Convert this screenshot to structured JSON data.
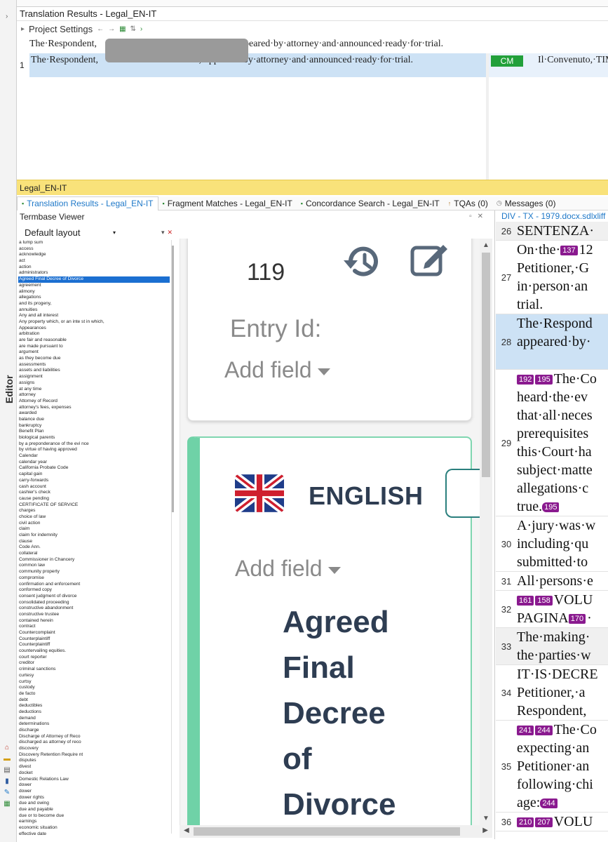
{
  "translation_results": {
    "title": "Translation Results - Legal_EN-IT",
    "project_settings": "Project Settings",
    "source_line": "The·Respondent,",
    "source_line_tail": "peared·by·attorney·and·announced·ready·for·trial.",
    "row_number": "1",
    "row_source_start": "The·Respondent,",
    "row_source_end": ",·appeared·by·attorney·and·announced·ready·for·trial.",
    "match_badge": "CM",
    "row_target": "Il·Convenuto,·TIM all’udienza."
  },
  "project_bar": "Legal_EN-IT",
  "tabs": [
    {
      "label": "Translation Results - Legal_EN-IT",
      "active": true
    },
    {
      "label": "Fragment Matches - Legal_EN-IT",
      "active": false
    },
    {
      "label": "Concordance Search - Legal_EN-IT",
      "active": false
    },
    {
      "label": "TQAs (0)",
      "active": false
    },
    {
      "label": "Messages (0)",
      "active": false
    }
  ],
  "termbase": {
    "title": "Termbase Viewer",
    "layout": "Default layout",
    "selected_term": "Agreed Final Decree of Divorce",
    "terms": [
      "a lump sum",
      "access",
      "acknowledge",
      "act",
      "action",
      "administrators",
      "Agreed Final Decree of Divorce",
      "agreement",
      "alimony",
      "allegations",
      "and its progeny,",
      "annuities",
      "Any and all interest",
      "Any property which, or an inte    st in which,",
      "Appearances",
      "arbitration",
      "are fair and reasonable",
      "are made pursuant to",
      "argument",
      "as they become due",
      "assessments",
      "assets and liabilities",
      "assignment",
      "assigns",
      "at any time",
      "attorney",
      "Attorney of Record",
      "attorney's fees, expenses",
      "awarded",
      "balance due",
      "bankruptcy",
      "Benefit Plan",
      "biological parents",
      "by a preponderance of the evi   nce",
      "by virtue of having approved",
      "Calendar",
      "calendar year",
      "California Probate Code",
      "capital gain",
      "carry-forwards",
      "cash account",
      "cashier's check",
      "cause pending",
      "CERTIFICATE OF SERVICE",
      "charges",
      "choice of law",
      "civil action",
      "claim",
      "claim for indemnity",
      "clause",
      "Code Ann.",
      "collateral",
      "Commissioner in Chancery",
      "common law",
      "community property",
      "compromise",
      "confirmation and enforcement",
      "conformed copy",
      "consent judgment of divorce",
      "consolidated proceeding",
      "constructive abandonment",
      "constructive trustee",
      "contained herein",
      "contract",
      "Countercomplaint",
      "Counterplaintiff",
      "Counterplaintiff",
      "countervailing equities.",
      "court reporter",
      "creditor",
      "criminal sanctions",
      "curtesy",
      "curtsy",
      "custody",
      "de facto",
      "debt",
      "deductibles",
      "deductions",
      "demand",
      "determinations",
      "discharge",
      "Discharge of Attorney of Reco",
      "discharged as attorney of reco",
      "discovery",
      "Discovery  Retention Require     nt",
      "disputes",
      "divest",
      "docket",
      "Domestic Relations Law",
      "dower",
      "dower",
      "dower rights",
      "due and owing",
      "due and payable",
      "due or to become due",
      "earnings",
      "economic situation",
      "effective date"
    ],
    "entry": {
      "entry_id_value": "119",
      "entry_id_label": "Entry Id:",
      "add_field": "Add field",
      "language": "ENGLISH",
      "add_field_2": "Add field",
      "term_lines": [
        "Agreed",
        "Final",
        "Decree",
        "of",
        "Divorce"
      ]
    }
  },
  "editor": {
    "title": "DIV - TX - 1979.docx.sdlxliff [",
    "rows": [
      {
        "n": "26",
        "lines": [
          [
            {
              "text": "SENTENZA·"
            }
          ]
        ],
        "style": "grey"
      },
      {
        "n": "27",
        "lines": [
          [
            {
              "text": "On·the·"
            },
            {
              "tag": "137"
            },
            {
              "text": "12"
            }
          ],
          [
            {
              "text": "Petitioner,·G"
            }
          ],
          [
            {
              "text": "in·person·an"
            }
          ],
          [
            {
              "text": "trial."
            }
          ]
        ],
        "style": ""
      },
      {
        "n": "28",
        "lines": [
          [
            {
              "text": "The·Respond"
            }
          ],
          [
            {
              "text": "appeared·by·"
            }
          ],
          [
            {
              "text": ""
            }
          ]
        ],
        "style": "hl"
      },
      {
        "n": "29",
        "lines": [
          [
            {
              "tag": "192"
            },
            {
              "tag": "195"
            },
            {
              "text": "The·Co"
            }
          ],
          [
            {
              "text": "heard·the·ev"
            }
          ],
          [
            {
              "text": "that·all·neces"
            }
          ],
          [
            {
              "text": "prerequisites"
            }
          ],
          [
            {
              "text": "this·Court·ha"
            }
          ],
          [
            {
              "text": "subject·matte"
            }
          ],
          [
            {
              "text": "allegations·c"
            }
          ],
          [
            {
              "text": "true."
            },
            {
              "tagend": "195"
            }
          ]
        ],
        "style": ""
      },
      {
        "n": "30",
        "lines": [
          [
            {
              "text": "A·jury·was·w"
            }
          ],
          [
            {
              "text": "including·qu"
            }
          ],
          [
            {
              "text": "submitted·to"
            }
          ]
        ],
        "style": ""
      },
      {
        "n": "31",
        "lines": [
          [
            {
              "text": "All·persons·e"
            }
          ]
        ],
        "style": ""
      },
      {
        "n": "32",
        "lines": [
          [
            {
              "tag": "161"
            },
            {
              "tag": "158"
            },
            {
              "text": "VOLU"
            }
          ],
          [
            {
              "text": "PAGINA"
            },
            {
              "tag": "170"
            },
            {
              "text": "·"
            }
          ]
        ],
        "style": ""
      },
      {
        "n": "33",
        "lines": [
          [
            {
              "text": "The·making·"
            }
          ],
          [
            {
              "text": "the·parties·w"
            }
          ]
        ],
        "style": "grey"
      },
      {
        "n": "34",
        "lines": [
          [
            {
              "text": "IT·IS·DECRE"
            }
          ],
          [
            {
              "text": "Petitioner,·a"
            }
          ],
          [
            {
              "text": "Respondent,"
            }
          ]
        ],
        "style": ""
      },
      {
        "n": "35",
        "lines": [
          [
            {
              "tag": "241"
            },
            {
              "tag": "244"
            },
            {
              "text": "The·Co"
            }
          ],
          [
            {
              "text": "expecting·an"
            }
          ],
          [
            {
              "text": "Petitioner·an"
            }
          ],
          [
            {
              "text": "following·chi"
            }
          ],
          [
            {
              "text": "age:"
            },
            {
              "tagend": "244"
            }
          ]
        ],
        "style": ""
      },
      {
        "n": "36",
        "lines": [
          [
            {
              "tag": "210"
            },
            {
              "tag": "207"
            },
            {
              "text": "VOLU"
            }
          ]
        ],
        "style": ""
      }
    ]
  },
  "rail": {
    "editor_label": "Editor"
  }
}
